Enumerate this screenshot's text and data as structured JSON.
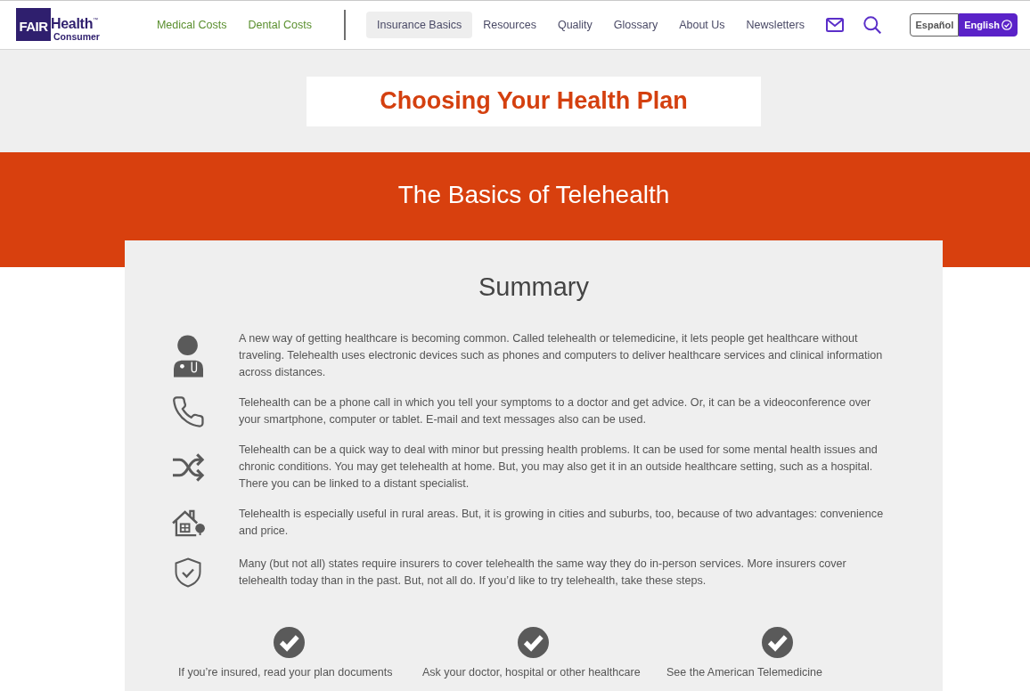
{
  "header": {
    "logo": {
      "badge": "FAIR",
      "wordmark": "Health",
      "trademark": "™",
      "tagline": "Consumer"
    },
    "cost_links": [
      "Medical Costs",
      "Dental Costs"
    ],
    "nav": [
      {
        "label": "Insurance Basics",
        "selected": true
      },
      {
        "label": "Resources",
        "selected": false
      },
      {
        "label": "Quality",
        "selected": false
      },
      {
        "label": "Glossary",
        "selected": false
      },
      {
        "label": "About Us",
        "selected": false
      },
      {
        "label": "Newsletters",
        "selected": false
      }
    ],
    "languages": [
      {
        "label": "Español",
        "selected": false
      },
      {
        "label": "English",
        "selected": true
      }
    ]
  },
  "plan_banner": {
    "title": "Choosing Your Health Plan"
  },
  "page_title": "The Basics of Telehealth",
  "summary": {
    "heading": "Summary",
    "items": [
      "A new way of getting healthcare is becoming common. Called telehealth or telemedicine, it lets people get healthcare without traveling. Telehealth uses electronic devices such as phones and computers to deliver healthcare services and clinical information across distances.",
      "Telehealth can be a phone call in which you tell your symptoms to a doctor and get advice. Or, it can be a videoconference over your smartphone, computer or tablet. E-mail and text messages also can be used.",
      "Telehealth can be a quick way to deal with minor but pressing health problems. It can be used for some mental health issues and chronic conditions. You may get telehealth at home. But, you may also get it in an outside healthcare setting, such as a hospital. There you can be linked to a distant specialist.",
      "Telehealth is especially useful in rural areas. But, it is growing in cities and suburbs, too, because of two advantages: convenience and price.",
      "Many (but not all) states require insurers to cover telehealth the same way they do in-person services. More insurers cover telehealth today than in the past. But, not all do. If you’d like to try telehealth, take these steps."
    ]
  },
  "steps": [
    "If you’re insured, read your plan documents",
    "Ask your doctor, hospital or other healthcare",
    "See the American Telemedicine"
  ]
}
